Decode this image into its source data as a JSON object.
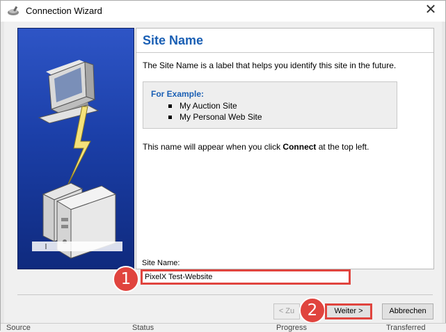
{
  "window": {
    "title": "Connection Wizard",
    "close_glyph": "✕"
  },
  "page": {
    "heading": "Site Name",
    "description": "The Site Name is a label that helps you identify this site in the future.",
    "example": {
      "heading": "For Example:",
      "items": [
        "My Auction Site",
        "My Personal Web Site"
      ]
    },
    "note_prefix": "This name will appear when you click ",
    "note_bold": "Connect",
    "note_suffix": " at the top left."
  },
  "form": {
    "site_name_label": "Site Name:",
    "site_name_value": "PixelX Test-Website"
  },
  "buttons": {
    "back": "< Zu",
    "next": "Weiter >",
    "cancel": "Abbrechen"
  },
  "annotations": {
    "step1": "1",
    "step2": "2"
  },
  "status_bar": [
    "Source",
    "Status",
    "Progress",
    "Transferred"
  ],
  "colors": {
    "accent_blue": "#1a5fb4",
    "highlight_red": "#e0443e",
    "panel_blue": "#1b3fa8"
  },
  "icons": {
    "title": "ftp-app-icon",
    "close": "close-icon"
  }
}
